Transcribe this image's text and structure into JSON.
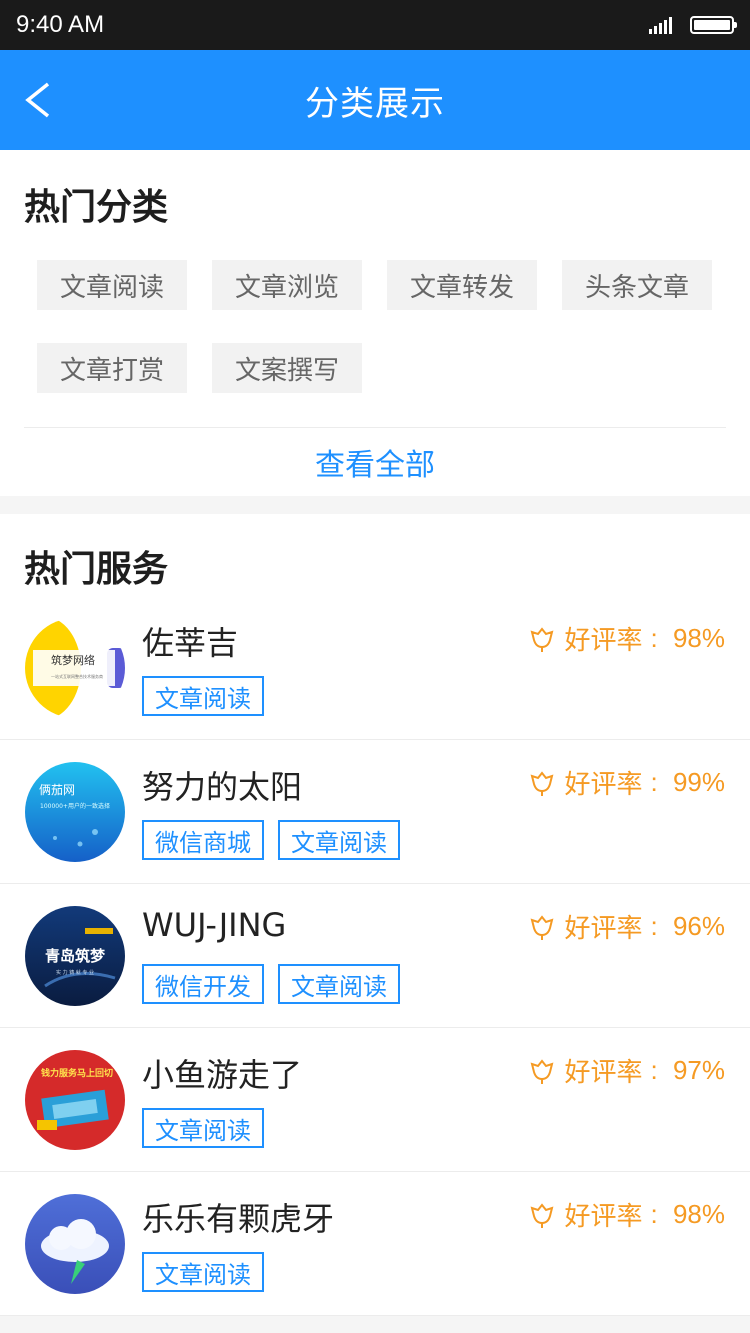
{
  "status": {
    "time": "9:40 AM"
  },
  "nav": {
    "title": "分类展示"
  },
  "hot_categories": {
    "title": "热门分类",
    "tags": [
      "文章阅读",
      "文章浏览",
      "文章转发",
      "头条文章",
      "文章打赏",
      "文案撰写"
    ],
    "view_all": "查看全部"
  },
  "hot_services": {
    "title": "热门服务",
    "rating_label": "好评率",
    "items": [
      {
        "name": "佐莘吉",
        "rating": "98%",
        "tags": [
          "文章阅读"
        ],
        "avatar_text": "筑梦网络",
        "avatar_sub": "一站式互联网整合技术服务商"
      },
      {
        "name": "努力的太阳",
        "rating": "99%",
        "tags": [
          "微信商城",
          "文章阅读"
        ],
        "avatar_text": "俩茄网",
        "avatar_sub": "100000+用户的一致选择"
      },
      {
        "name": "WUJ-JING",
        "rating": "96%",
        "tags": [
          "微信开发",
          "文章阅读"
        ],
        "avatar_text": "青岛筑梦",
        "avatar_sub": "实 力 铸 就 专 业"
      },
      {
        "name": "小鱼游走了",
        "rating": "97%",
        "tags": [
          "文章阅读"
        ],
        "avatar_text": "钱力服务马上回切"
      },
      {
        "name": "乐乐有颗虎牙",
        "rating": "98%",
        "tags": [
          "文章阅读"
        ]
      }
    ]
  },
  "colors": {
    "accent": "#1e90ff",
    "rating": "#f59a23",
    "status_bar": "#1a1a1a"
  }
}
